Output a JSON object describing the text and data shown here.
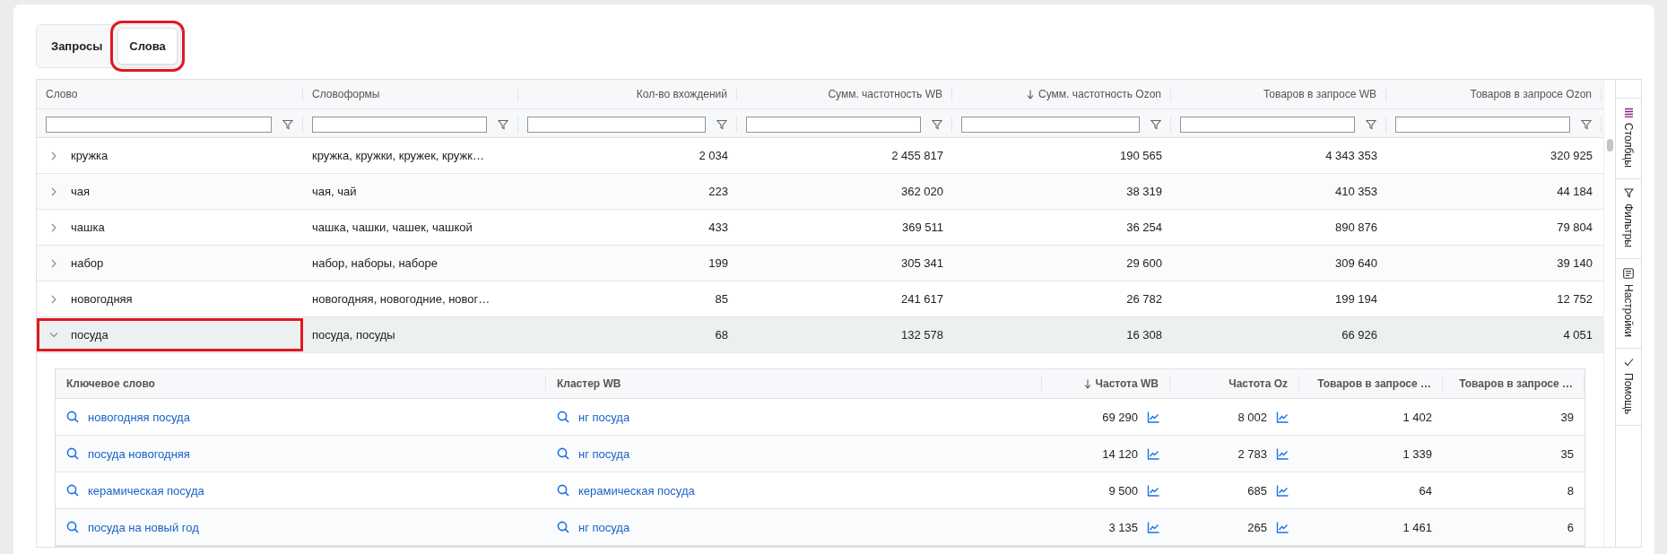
{
  "tabs": [
    {
      "label": "Запросы",
      "selected": false,
      "highlighted": false
    },
    {
      "label": "Слова",
      "selected": true,
      "highlighted": true
    }
  ],
  "table": {
    "columns": [
      {
        "label": "Слово",
        "sorted": false
      },
      {
        "label": "Словоформы",
        "sorted": false
      },
      {
        "label": "Кол-во вхождений",
        "sorted": false
      },
      {
        "label": "Сумм. частотность WB",
        "sorted": false
      },
      {
        "label": "Сумм. частотность Ozon",
        "sorted": true
      },
      {
        "label": "Товаров в запросе WB",
        "sorted": false
      },
      {
        "label": "Товаров в запросе Ozon",
        "sorted": false
      }
    ],
    "rows": [
      {
        "expanded": false,
        "highlighted": false,
        "cells": [
          "кружка",
          "кружка, кружки, кружек, кружк…",
          "2 034",
          "2 455 817",
          "190 565",
          "4 343 353",
          "320 925"
        ]
      },
      {
        "expanded": false,
        "highlighted": false,
        "cells": [
          "чая",
          "чая, чай",
          "223",
          "362 020",
          "38 319",
          "410 353",
          "44 184"
        ]
      },
      {
        "expanded": false,
        "highlighted": false,
        "cells": [
          "чашка",
          "чашка, чашки, чашек, чашкой",
          "433",
          "369 511",
          "36 254",
          "890 876",
          "79 804"
        ]
      },
      {
        "expanded": false,
        "highlighted": false,
        "cells": [
          "набор",
          "набор, наборы, наборе",
          "199",
          "305 341",
          "29 600",
          "309 640",
          "39 140"
        ]
      },
      {
        "expanded": false,
        "highlighted": false,
        "cells": [
          "новогодняя",
          "новогодняя, новогодние, новог…",
          "85",
          "241 617",
          "26 782",
          "199 194",
          "12 752"
        ]
      },
      {
        "expanded": true,
        "highlighted": true,
        "cells": [
          "посуда",
          "посуда, посуды",
          "68",
          "132 578",
          "16 308",
          "66 926",
          "4 051"
        ]
      }
    ]
  },
  "detail": {
    "columns": [
      {
        "label": "Ключевое слово",
        "sorted": false
      },
      {
        "label": "Кластер WB",
        "sorted": false
      },
      {
        "label": "Частота WB",
        "sorted": true
      },
      {
        "label": "Частота Oz",
        "sorted": false
      },
      {
        "label": "Товаров в запросе …",
        "sorted": false
      },
      {
        "label": "Товаров в запросе …",
        "sorted": false
      }
    ],
    "rows": [
      {
        "keyword": "новогодняя посуда",
        "cluster": "нг посуда",
        "freq_wb": "69 290",
        "freq_oz": "8 002",
        "column_5": "1 402",
        "column_6": "39"
      },
      {
        "keyword": "посуда новогодняя",
        "cluster": "нг посуда",
        "freq_wb": "14 120",
        "freq_oz": "2 783",
        "column_5": "1 339",
        "column_6": "35"
      },
      {
        "keyword": "керамическая посуда",
        "cluster": "керамическая посуда",
        "freq_wb": "9 500",
        "freq_oz": "685",
        "column_5": "64",
        "column_6": "8"
      },
      {
        "keyword": "посуда на новый год",
        "cluster": "нг посуда",
        "freq_wb": "3 135",
        "freq_oz": "265",
        "column_5": "1 461",
        "column_6": "6"
      }
    ]
  },
  "side_panel": [
    {
      "label": "Столбцы",
      "kind": "columns"
    },
    {
      "label": "Фильтры",
      "kind": "filters"
    },
    {
      "label": "Настройки",
      "kind": "settings"
    },
    {
      "label": "Помощь",
      "kind": "help"
    }
  ]
}
